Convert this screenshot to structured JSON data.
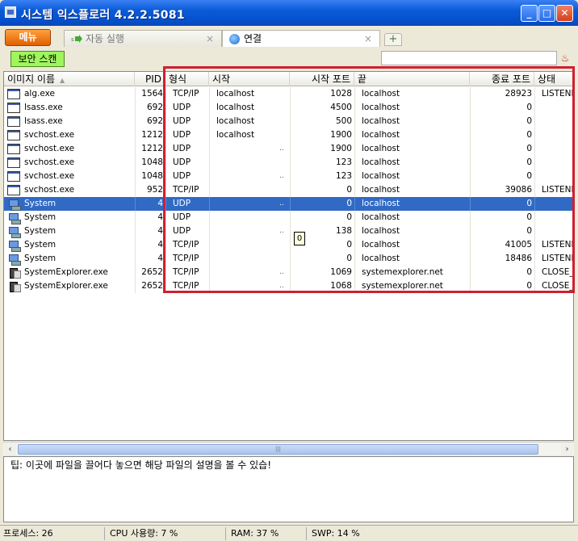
{
  "window": {
    "title": "시스템 익스플로러 4.2.2.5081",
    "min": "_",
    "max": "□",
    "close": "✕"
  },
  "toolbar": {
    "menu_label": "메뉴",
    "scan_label": "보안 스캔",
    "new_tab": "+",
    "filter_placeholder": ""
  },
  "tabs": [
    {
      "label": "자동 실행",
      "icon": "startup-icon",
      "close": "×",
      "active": false
    },
    {
      "label": "연결",
      "icon": "globe-icon",
      "close": "×",
      "active": true
    }
  ],
  "columns": {
    "image": "이미지 이름",
    "pid": "PID",
    "type": "형식",
    "start": "시작",
    "start_port": "시작 포트",
    "end": "끝",
    "end_port": "종료 포트",
    "state": "상태"
  },
  "rows": [
    {
      "image": "alg.exe",
      "pid": "1564",
      "type": "TCP/IP",
      "start": "localhost",
      "start_port": "1028",
      "end": "localhost",
      "end_port": "28923",
      "state": "LISTENI",
      "dots": "",
      "icon": "window",
      "selected": false
    },
    {
      "image": "lsass.exe",
      "pid": "692",
      "type": "UDP",
      "start": "localhost",
      "start_port": "4500",
      "end": "localhost",
      "end_port": "0",
      "state": "",
      "dots": "",
      "icon": "window",
      "selected": false
    },
    {
      "image": "lsass.exe",
      "pid": "692",
      "type": "UDP",
      "start": "localhost",
      "start_port": "500",
      "end": "localhost",
      "end_port": "0",
      "state": "",
      "dots": "",
      "icon": "window",
      "selected": false
    },
    {
      "image": "svchost.exe",
      "pid": "1212",
      "type": "UDP",
      "start": "localhost",
      "start_port": "1900",
      "end": "localhost",
      "end_port": "0",
      "state": "",
      "dots": "",
      "icon": "window",
      "selected": false
    },
    {
      "image": "svchost.exe",
      "pid": "1212",
      "type": "UDP",
      "start": "",
      "start_port": "1900",
      "end": "localhost",
      "end_port": "0",
      "state": "",
      "dots": "..",
      "icon": "window",
      "selected": false
    },
    {
      "image": "svchost.exe",
      "pid": "1048",
      "type": "UDP",
      "start": "",
      "start_port": "123",
      "end": "localhost",
      "end_port": "0",
      "state": "",
      "dots": "",
      "icon": "window",
      "selected": false
    },
    {
      "image": "svchost.exe",
      "pid": "1048",
      "type": "UDP",
      "start": "",
      "start_port": "123",
      "end": "localhost",
      "end_port": "0",
      "state": "",
      "dots": "..",
      "icon": "window",
      "selected": false
    },
    {
      "image": "svchost.exe",
      "pid": "952",
      "type": "TCP/IP",
      "start": "",
      "start_port": "0",
      "end": "localhost",
      "end_port": "39086",
      "state": "LISTENI",
      "dots": "",
      "icon": "window",
      "selected": false
    },
    {
      "image": "System",
      "pid": "4",
      "type": "UDP",
      "start": "",
      "start_port": "0",
      "end": "localhost",
      "end_port": "0",
      "state": "",
      "dots": "..",
      "icon": "system",
      "selected": true
    },
    {
      "image": "System",
      "pid": "4",
      "type": "UDP",
      "start": "",
      "start_port": "0",
      "end": "localhost",
      "end_port": "0",
      "state": "",
      "dots": "",
      "icon": "system",
      "selected": false
    },
    {
      "image": "System",
      "pid": "4",
      "type": "UDP",
      "start": "",
      "start_port": "138",
      "end": "localhost",
      "end_port": "0",
      "state": "",
      "dots": "..",
      "icon": "system",
      "selected": false
    },
    {
      "image": "System",
      "pid": "4",
      "type": "TCP/IP",
      "start": "",
      "start_port": "0",
      "end": "localhost",
      "end_port": "41005",
      "state": "LISTENI",
      "dots": "",
      "icon": "system",
      "selected": false
    },
    {
      "image": "System",
      "pid": "4",
      "type": "TCP/IP",
      "start": "",
      "start_port": "0",
      "end": "localhost",
      "end_port": "18486",
      "state": "LISTENI",
      "dots": "",
      "icon": "system",
      "selected": false
    },
    {
      "image": "SystemExplorer.exe",
      "pid": "2652",
      "type": "TCP/IP",
      "start": "",
      "start_port": "1069",
      "end": "systemexplorer.net",
      "end_port": "0",
      "state": "CLOSE_",
      "dots": "..",
      "icon": "sysexp",
      "selected": false
    },
    {
      "image": "SystemExplorer.exe",
      "pid": "2652",
      "type": "TCP/IP",
      "start": "",
      "start_port": "1068",
      "end": "systemexplorer.net",
      "end_port": "0",
      "state": "CLOSE_",
      "dots": "..",
      "icon": "sysexp",
      "selected": false
    }
  ],
  "tooltip": "0",
  "scrollbar": {
    "left": "‹",
    "right": "›",
    "grip": "|||"
  },
  "hint": "팁: 이곳에 파일을 끌어다 놓으면 해당 파일의 설명을 볼 수 있습!",
  "status": {
    "processes": "프로세스: 26",
    "cpu": "CPU 사용량: 7 %",
    "ram": "RAM: 37 %",
    "swp": "SWP: 14 %"
  },
  "colors": {
    "selection": "#316ac5",
    "highlight_border": "#d02030",
    "scan_button": "#9ef55c",
    "menu_button": "#f07010"
  }
}
